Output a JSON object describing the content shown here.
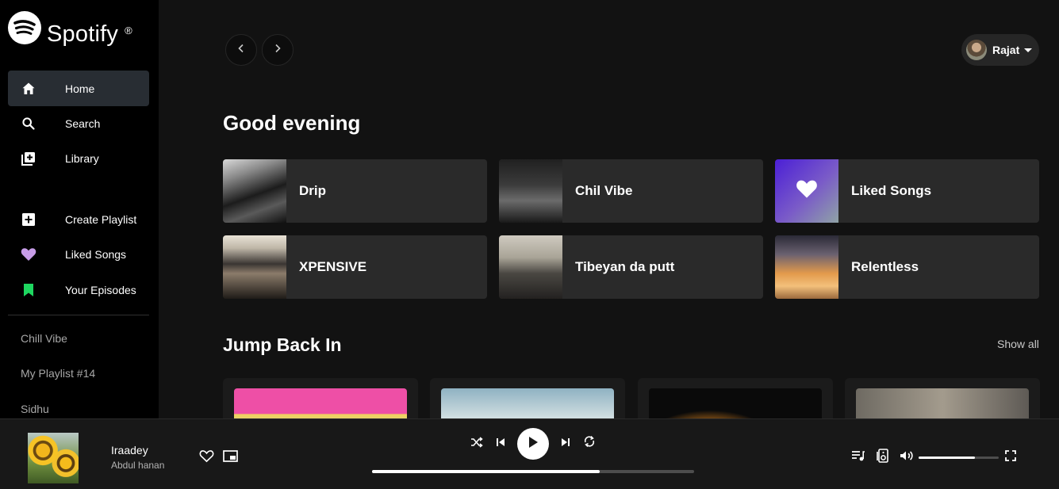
{
  "brand": {
    "name": "Spotify",
    "reg": "®"
  },
  "nav": [
    {
      "label": "Home",
      "icon": "home-icon",
      "active": true
    },
    {
      "label": "Search",
      "icon": "search-icon"
    },
    {
      "label": "Library",
      "icon": "library-icon"
    },
    {
      "label": "Create Playlist",
      "icon": "plus-icon"
    },
    {
      "label": "Liked Songs",
      "icon": "heart-icon",
      "icon_color": "#c79de8"
    },
    {
      "label": "Your Episodes",
      "icon": "bookmark-icon",
      "icon_color": "#1ed760"
    }
  ],
  "playlists": [
    "Chill Vibe",
    "My Playlist #14",
    "Sidhu"
  ],
  "header": {
    "back_icon": "chevron-left-icon",
    "forward_icon": "chevron-right-icon",
    "user_name": "Rajat"
  },
  "greeting": "Good evening",
  "quick_picks": [
    {
      "title": "Drip"
    },
    {
      "title": "Chil Vibe"
    },
    {
      "title": "Liked Songs"
    },
    {
      "title": "XPENSIVE"
    },
    {
      "title": "Tibeyan da putt"
    },
    {
      "title": "Relentless"
    }
  ],
  "jump_back": {
    "title": "Jump Back In",
    "show_all": "Show all"
  },
  "player": {
    "track": "Iraadey",
    "artist": "Abdul hanan",
    "progress": 0.706,
    "volume": 0.7,
    "colors": {
      "accent": "#1ed760",
      "bar_bg": "#4d4d4d"
    }
  }
}
